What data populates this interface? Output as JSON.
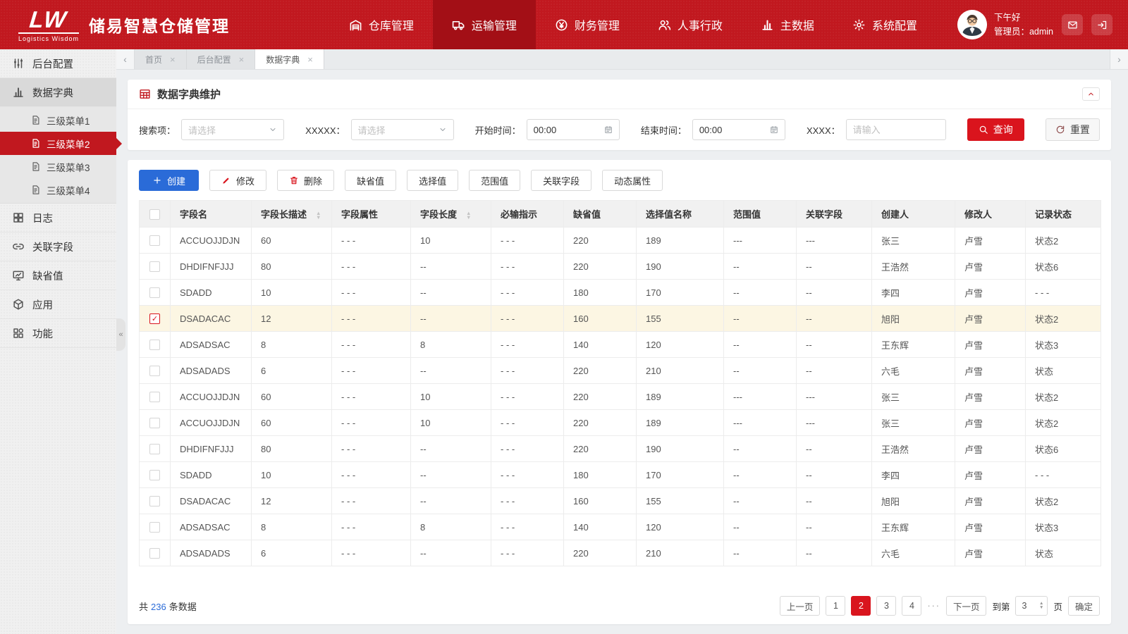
{
  "colors": {
    "header_red": "#c1181f",
    "header_red_active": "#a30f16",
    "accent_red": "#da141d",
    "primary_blue": "#2a6bd8",
    "selected_row_bg": "#fcf6e3"
  },
  "header": {
    "logo_mark": "LW",
    "logo_subtitle": "Logistics Wisdom",
    "app_title": "储易智慧仓储管理",
    "nav_items": [
      {
        "name": "nav-warehouse-mgmt",
        "label": "仓库管理",
        "icon": "warehouse-icon",
        "active": false
      },
      {
        "name": "nav-transport-mgmt",
        "label": "运输管理",
        "icon": "truck-icon",
        "active": true
      },
      {
        "name": "nav-finance-mgmt",
        "label": "财务管理",
        "icon": "finance-icon",
        "active": false
      },
      {
        "name": "nav-hr-admin",
        "label": "人事行政",
        "icon": "hr-icon",
        "active": false
      },
      {
        "name": "nav-master-data",
        "label": "主数据",
        "icon": "master-data-icon",
        "active": false
      },
      {
        "name": "nav-system-config",
        "label": "系统配置",
        "icon": "system-config-icon",
        "active": false
      }
    ],
    "user_greeting": "下午好",
    "user_role": "管理员：admin"
  },
  "sidebar": {
    "items": [
      {
        "name": "sidebar-item-backend-config",
        "label": "后台配置",
        "icon": "sliders-icon",
        "type": "top",
        "state": "normal"
      },
      {
        "name": "sidebar-item-data-dictionary",
        "label": "数据字典",
        "icon": "chart-icon",
        "type": "top",
        "state": "expanded"
      },
      {
        "name": "sidebar-item-submenu-1",
        "label": "三级菜单1",
        "icon": "doc-icon",
        "type": "sub",
        "state": "normal"
      },
      {
        "name": "sidebar-item-submenu-2",
        "label": "三级菜单2",
        "icon": "doc-icon",
        "type": "sub",
        "state": "active"
      },
      {
        "name": "sidebar-item-submenu-3",
        "label": "三级菜单3",
        "icon": "doc-icon",
        "type": "sub",
        "state": "normal"
      },
      {
        "name": "sidebar-item-submenu-4",
        "label": "三级菜单4",
        "icon": "doc-icon",
        "type": "sub",
        "state": "normal"
      },
      {
        "name": "sidebar-item-logs",
        "label": "日志",
        "icon": "grid-icon",
        "type": "top",
        "state": "normal"
      },
      {
        "name": "sidebar-item-related-fields",
        "label": "关联字段",
        "icon": "link-icon",
        "type": "top",
        "state": "normal"
      },
      {
        "name": "sidebar-item-default-values",
        "label": "缺省值",
        "icon": "monitor-icon",
        "type": "top",
        "state": "normal"
      },
      {
        "name": "sidebar-item-applications",
        "label": "应用",
        "icon": "cube-icon",
        "type": "top",
        "state": "normal"
      },
      {
        "name": "sidebar-item-functions",
        "label": "功能",
        "icon": "apps-icon",
        "type": "top",
        "state": "normal"
      }
    ],
    "collapse_glyph": "«"
  },
  "tabs": {
    "items": [
      {
        "name": "tab-home",
        "label": "首页",
        "active": false
      },
      {
        "name": "tab-backend-config",
        "label": "后台配置",
        "active": false
      },
      {
        "name": "tab-data-dictionary",
        "label": "数据字典",
        "active": true
      }
    ]
  },
  "toolbar_panel": {
    "title": "数据字典维护",
    "filters": [
      {
        "name": "filter-search-item",
        "label": "搜索项：",
        "type": "select",
        "value": "请选择"
      },
      {
        "name": "filter-xxxxx",
        "label": "XXXXX：",
        "type": "select",
        "value": "请选择"
      },
      {
        "name": "filter-start-time",
        "label": "开始时间：",
        "type": "time",
        "value": "00:00"
      },
      {
        "name": "filter-end-time",
        "label": "结束时间：",
        "type": "time",
        "value": "00:00"
      },
      {
        "name": "filter-xxxx",
        "label": "XXXX：",
        "type": "text",
        "placeholder": "请输入"
      }
    ],
    "search_label": "查询",
    "reset_label": "重置"
  },
  "table_panel": {
    "actions": [
      {
        "name": "create-button",
        "label": "创建",
        "icon": "plus-icon",
        "style": "primary"
      },
      {
        "name": "modify-button",
        "label": "修改",
        "icon": "pencil-icon",
        "style": "default"
      },
      {
        "name": "delete-button",
        "label": "删除",
        "icon": "trash-icon",
        "style": "default"
      },
      {
        "name": "default-value-button",
        "label": "缺省值",
        "style": "default"
      },
      {
        "name": "select-value-button",
        "label": "选择值",
        "style": "default"
      },
      {
        "name": "range-value-button",
        "label": "范围值",
        "style": "default"
      },
      {
        "name": "related-field-button",
        "label": "关联字段",
        "style": "default"
      },
      {
        "name": "dynamic-attr-button",
        "label": "动态属性",
        "style": "default"
      }
    ],
    "columns": [
      {
        "label": "字段名"
      },
      {
        "label": "字段长描述",
        "sortable": true
      },
      {
        "label": "字段属性"
      },
      {
        "label": "字段长度",
        "sortable": true
      },
      {
        "label": "必输指示"
      },
      {
        "label": "缺省值"
      },
      {
        "label": "选择值名称"
      },
      {
        "label": "范围值"
      },
      {
        "label": "关联字段"
      },
      {
        "label": "创建人"
      },
      {
        "label": "修改人"
      },
      {
        "label": "记录状态"
      }
    ],
    "rows": [
      {
        "checked": false,
        "cells": [
          "ACCUOJJDJN",
          "60",
          "- - -",
          "10",
          "- - -",
          "220",
          "189",
          "---",
          "---",
          "张三",
          "卢雪",
          "状态2"
        ]
      },
      {
        "checked": false,
        "cells": [
          "DHDIFNFJJJ",
          "80",
          "- - -",
          "--",
          "- - -",
          "220",
          "190",
          "--",
          "--",
          "王浩然",
          "卢雪",
          "状态6"
        ]
      },
      {
        "checked": false,
        "cells": [
          "SDADD",
          "10",
          "- - -",
          "--",
          "- - -",
          "180",
          "170",
          "--",
          "--",
          "李四",
          "卢雪",
          "- - -"
        ]
      },
      {
        "checked": true,
        "cells": [
          "DSADACAC",
          "12",
          "- - -",
          "--",
          "- - -",
          "160",
          "155",
          "--",
          "--",
          "旭阳",
          "卢雪",
          "状态2"
        ]
      },
      {
        "checked": false,
        "cells": [
          "ADSADSAC",
          "8",
          "- - -",
          "8",
          "- - -",
          "140",
          "120",
          "--",
          "--",
          "王东辉",
          "卢雪",
          "状态3"
        ]
      },
      {
        "checked": false,
        "cells": [
          "ADSADADS",
          "6",
          "- - -",
          "--",
          "- - -",
          "220",
          "210",
          "--",
          "--",
          "六毛",
          "卢雪",
          "状态"
        ]
      },
      {
        "checked": false,
        "cells": [
          "ACCUOJJDJN",
          "60",
          "- - -",
          "10",
          "- - -",
          "220",
          "189",
          "---",
          "---",
          "张三",
          "卢雪",
          "状态2"
        ]
      },
      {
        "checked": false,
        "cells": [
          "ACCUOJJDJN",
          "60",
          "- - -",
          "10",
          "- - -",
          "220",
          "189",
          "---",
          "---",
          "张三",
          "卢雪",
          "状态2"
        ]
      },
      {
        "checked": false,
        "cells": [
          "DHDIFNFJJJ",
          "80",
          "- - -",
          "--",
          "- - -",
          "220",
          "190",
          "--",
          "--",
          "王浩然",
          "卢雪",
          "状态6"
        ]
      },
      {
        "checked": false,
        "cells": [
          "SDADD",
          "10",
          "- - -",
          "--",
          "- - -",
          "180",
          "170",
          "--",
          "--",
          "李四",
          "卢雪",
          "- - -"
        ]
      },
      {
        "checked": false,
        "cells": [
          "DSADACAC",
          "12",
          "- - -",
          "--",
          "- - -",
          "160",
          "155",
          "--",
          "--",
          "旭阳",
          "卢雪",
          "状态2"
        ]
      },
      {
        "checked": false,
        "cells": [
          "ADSADSAC",
          "8",
          "- - -",
          "8",
          "- - -",
          "140",
          "120",
          "--",
          "--",
          "王东辉",
          "卢雪",
          "状态3"
        ]
      },
      {
        "checked": false,
        "cells": [
          "ADSADADS",
          "6",
          "- - -",
          "--",
          "- - -",
          "220",
          "210",
          "--",
          "--",
          "六毛",
          "卢雪",
          "状态"
        ]
      }
    ]
  },
  "pagination": {
    "total_prefix": "共",
    "total_count": "236",
    "total_suffix": "条数据",
    "prev_label": "上一页",
    "next_label": "下一页",
    "pages": [
      "1",
      "2",
      "3",
      "4"
    ],
    "active_page": "2",
    "ellipsis": "···",
    "goto_prefix": "到第",
    "goto_value": "3",
    "goto_suffix": "页",
    "confirm_label": "确定"
  }
}
